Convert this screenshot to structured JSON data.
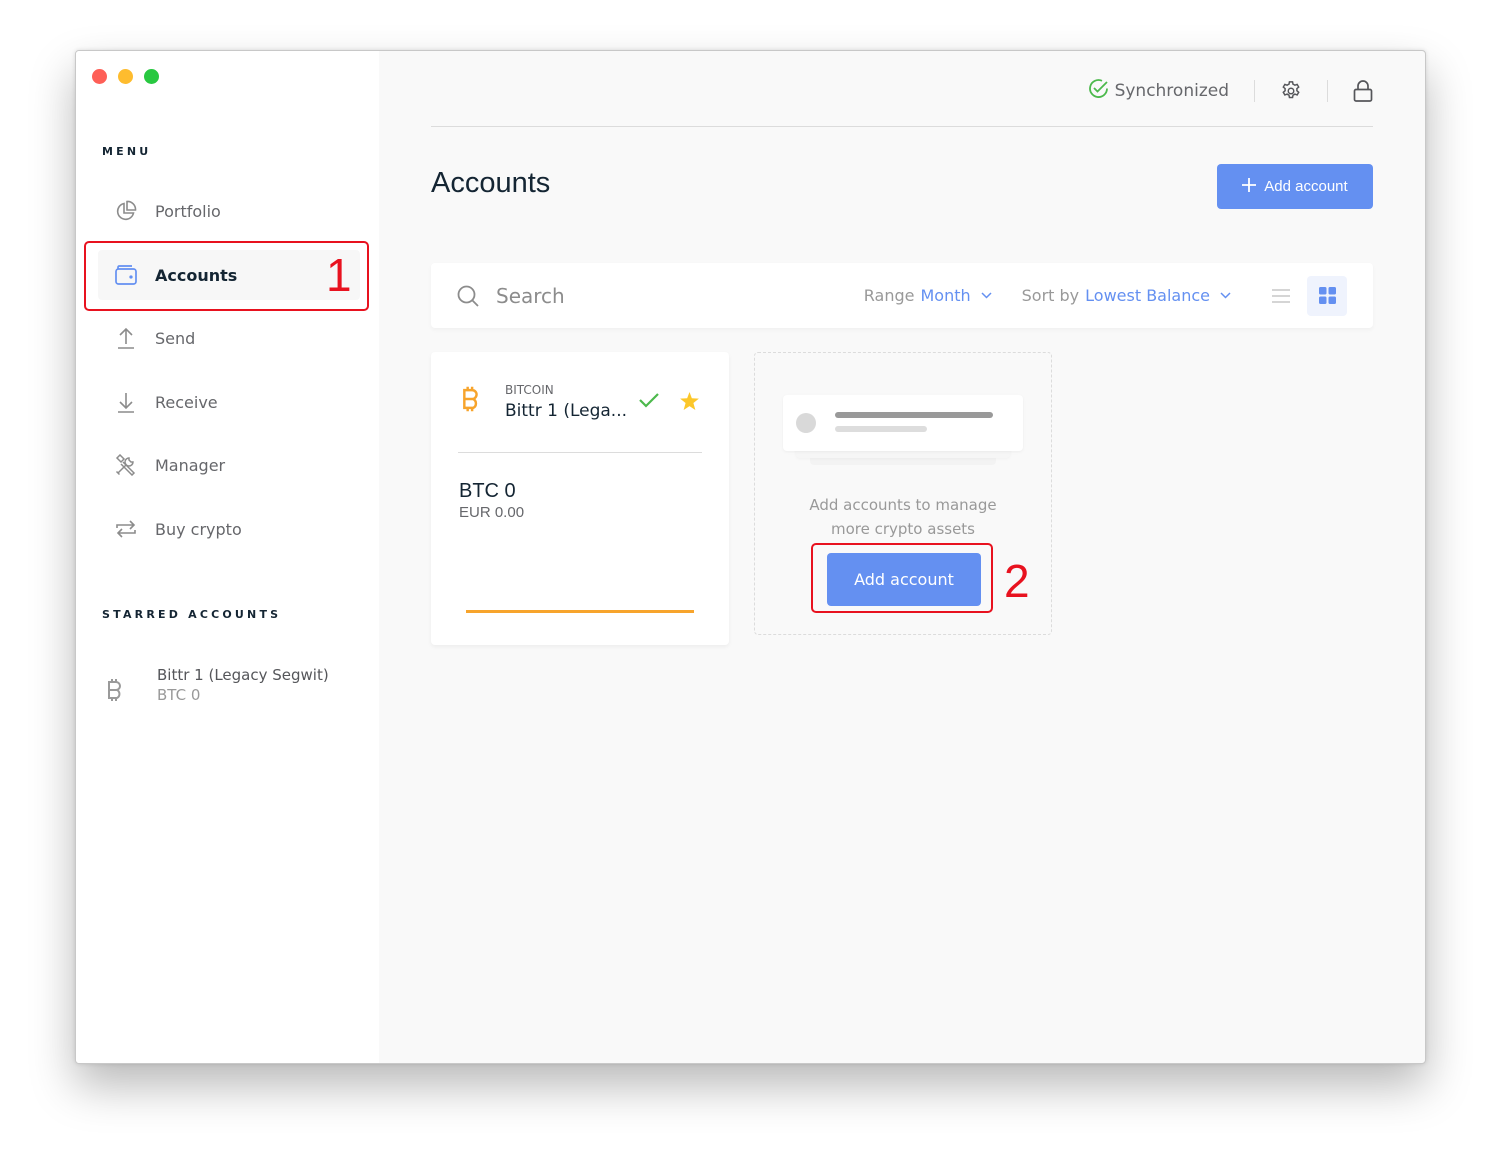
{
  "window": {
    "controls": [
      "close",
      "minimize",
      "zoom"
    ]
  },
  "sidebar": {
    "menu_title": "MENU",
    "items": [
      {
        "label": "Portfolio",
        "icon": "pie-chart-icon",
        "active": false
      },
      {
        "label": "Accounts",
        "icon": "wallet-icon",
        "active": true
      },
      {
        "label": "Send",
        "icon": "arrow-up-icon",
        "active": false
      },
      {
        "label": "Receive",
        "icon": "arrow-down-icon",
        "active": false
      },
      {
        "label": "Manager",
        "icon": "tools-icon",
        "active": false
      },
      {
        "label": "Buy crypto",
        "icon": "exchange-icon",
        "active": false
      }
    ],
    "starred_title": "STARRED ACCOUNTS",
    "starred": [
      {
        "name": "Bittr 1 (Legacy Segwit)",
        "balance": "BTC 0",
        "icon": "bitcoin-icon"
      }
    ]
  },
  "topbar": {
    "sync_status": "Synchronized",
    "settings_icon": "gear-icon",
    "lock_icon": "lock-icon"
  },
  "page": {
    "title": "Accounts",
    "add_account_label": "Add account"
  },
  "toolbar": {
    "search_placeholder": "Search",
    "range_label": "Range",
    "range_value": "Month",
    "sort_label": "Sort by",
    "sort_value": "Lowest Balance",
    "view_modes": [
      "list",
      "grid"
    ],
    "active_view": "grid"
  },
  "accounts": [
    {
      "family": "BITCOIN",
      "name": "Bittr 1 (Lega...",
      "balance": "BTC 0",
      "fiat": "EUR 0.00",
      "synced": true,
      "starred": true
    }
  ],
  "empty_card": {
    "text_line1": "Add accounts to manage",
    "text_line2": "more crypto assets",
    "button_label": "Add account"
  },
  "annotations": [
    {
      "number": "1",
      "target": "sidebar Accounts item"
    },
    {
      "number": "2",
      "target": "Add account button"
    }
  ],
  "colors": {
    "accent": "#6490f1",
    "bitcoin": "#f7a42c",
    "success": "#4cb94c",
    "star": "#fcc72a",
    "annotation": "#e8121f"
  }
}
